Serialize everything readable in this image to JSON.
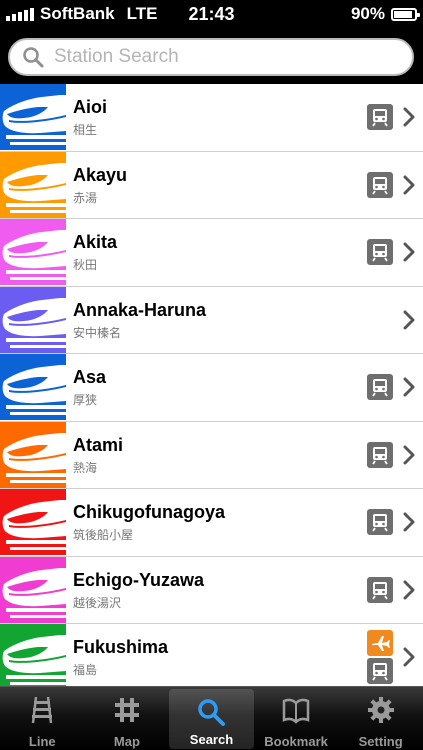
{
  "status": {
    "carrier": "SoftBank",
    "network": "LTE",
    "time": "21:43",
    "battery": "90%",
    "battery_level": 0.9
  },
  "search": {
    "placeholder": "Station Search",
    "value": ""
  },
  "stations": [
    {
      "name": "Aioi",
      "kanji": "相生",
      "color": "#0b63d6",
      "icons": [
        "train-icon"
      ]
    },
    {
      "name": "Akayu",
      "kanji": "赤湯",
      "color": "#ff9a00",
      "icons": [
        "train-icon"
      ]
    },
    {
      "name": "Akita",
      "kanji": "秋田",
      "color": "#f05cf0",
      "icons": [
        "train-icon"
      ]
    },
    {
      "name": "Annaka-Haruna",
      "kanji": "安中榛名",
      "color": "#6b5cf2",
      "icons": []
    },
    {
      "name": "Asa",
      "kanji": "厚狭",
      "color": "#0b63d6",
      "icons": [
        "train-icon"
      ]
    },
    {
      "name": "Atami",
      "kanji": "熱海",
      "color": "#ff6a00",
      "icons": [
        "train-icon"
      ]
    },
    {
      "name": "Chikugofunagoya",
      "kanji": "筑後船小屋",
      "color": "#f01414",
      "icons": [
        "train-icon"
      ]
    },
    {
      "name": "Echigo-Yuzawa",
      "kanji": "越後湯沢",
      "color": "#f03cd0",
      "icons": [
        "train-icon"
      ]
    },
    {
      "name": "Fukushima",
      "kanji": "福島",
      "color": "#12a532",
      "icons": [
        "airplane-icon",
        "train-icon"
      ]
    }
  ],
  "tabs": [
    {
      "label": "Line",
      "icon": "railway-track-icon",
      "active": false
    },
    {
      "label": "Map",
      "icon": "map-grid-icon",
      "active": false
    },
    {
      "label": "Search",
      "icon": "search-icon",
      "active": true
    },
    {
      "label": "Bookmark",
      "icon": "book-icon",
      "active": false
    },
    {
      "label": "Setting",
      "icon": "gear-icon",
      "active": false
    }
  ]
}
